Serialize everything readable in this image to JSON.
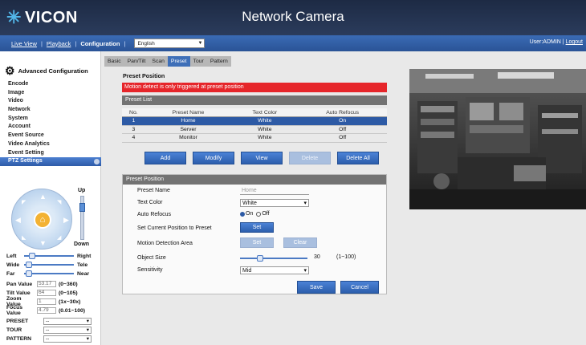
{
  "header": {
    "brand": "VICON",
    "title": "Network Camera"
  },
  "nav": {
    "live_view": "Live View",
    "playback": "Playback",
    "configuration": "Configuration",
    "separator": "|",
    "language": "English",
    "user": "User:ADMIN",
    "logout": "Logout"
  },
  "sidebar": {
    "heading": "Advanced Configuration",
    "items": [
      {
        "label": "Encode"
      },
      {
        "label": "Image"
      },
      {
        "label": "Video"
      },
      {
        "label": "Network"
      },
      {
        "label": "System"
      },
      {
        "label": "Account"
      },
      {
        "label": "Event Source"
      },
      {
        "label": "Video Analytics"
      },
      {
        "label": "Event Setting"
      },
      {
        "label": "PTZ Settings"
      }
    ],
    "ptz": {
      "up": "Up",
      "down": "Down",
      "left": "Left",
      "right": "Right",
      "wide": "Wide",
      "tele": "Tele",
      "far": "Far",
      "near": "Near",
      "pan_label": "Pan Value",
      "pan_value": "53.17",
      "pan_range": "(0~360)",
      "tilt_label": "Tilt Value",
      "tilt_value": "64",
      "tilt_range": "(0~105)",
      "zoom_label": "Zoom Value",
      "zoom_value": "1",
      "zoom_range": "(1x~30x)",
      "focus_label": "Focus Value",
      "focus_value": "4.79",
      "focus_range": "(0.01~100)",
      "preset_label": "PRESET",
      "preset_value": "--",
      "tour_label": "TOUR",
      "tour_value": "--",
      "pattern_label": "PATTERN",
      "pattern_value": "--"
    }
  },
  "tabs": [
    "Basic",
    "Pan/Tilt",
    "Scan",
    "Preset",
    "Tour",
    "Pattern"
  ],
  "preset": {
    "section_title": "Preset Position",
    "alert": "Motion detect is only triggered at preset position",
    "list_title": "Preset List",
    "columns": [
      "No.",
      "Preset Name",
      "Text Color",
      "Auto Refocus"
    ],
    "rows": [
      {
        "no": "1",
        "name": "Home",
        "color": "White",
        "refocus": "On"
      },
      {
        "no": "3",
        "name": "Server",
        "color": "White",
        "refocus": "Off"
      },
      {
        "no": "4",
        "name": "Monitor",
        "color": "White",
        "refocus": "Off"
      }
    ],
    "buttons": {
      "add": "Add",
      "modify": "Modify",
      "view": "View",
      "delete": "Delete",
      "delete_all": "Delete All"
    },
    "form": {
      "title": "Preset Position",
      "name_label": "Preset Name",
      "name_placeholder": "Home",
      "color_label": "Text Color",
      "color_value": "White",
      "refocus_label": "Auto Refocus",
      "refocus_on": "On",
      "refocus_off": "Off",
      "set_pos_label": "Set Current Position to Preset",
      "set_btn": "Set",
      "motion_label": "Motion Detection Area",
      "motion_set": "Set",
      "motion_clear": "Clear",
      "size_label": "Object Size",
      "size_value": "30",
      "size_range": "(1~100)",
      "size_level": 0.3,
      "sens_label": "Sensitivity",
      "sens_value": "Mid"
    },
    "save": "Save",
    "cancel": "Cancel"
  },
  "colors": {
    "accent": "#3e6fb8",
    "alert": "#e6252a",
    "header": "#1d2a44"
  }
}
